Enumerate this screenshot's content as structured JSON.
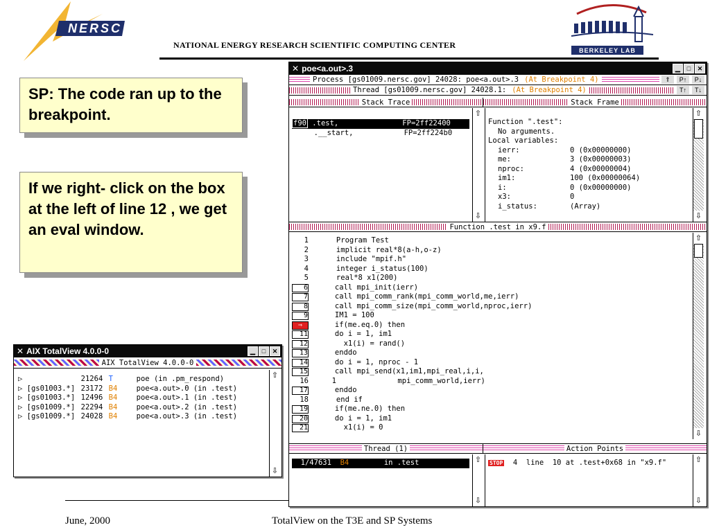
{
  "header": {
    "org_logo": "NERSC",
    "org_title": "National Energy Research Scientific Computing Center",
    "lab_logo": "Berkeley Lab"
  },
  "callouts": [
    {
      "text": "SP: The code ran up to the breakpoint."
    },
    {
      "text": "If we right- click on the box at the left of line 12 , we get an eval window."
    }
  ],
  "process_window": {
    "title": "poe<a.out>.3",
    "process_bar": {
      "text": "Process [gs01009.nersc.gov] 24028: poe<a.out>.3",
      "status": "(At Breakpoint 4)"
    },
    "thread_bar": {
      "text": "Thread [gs01009.nersc.gov] 24028.1:",
      "status": "(At Breakpoint 4)"
    },
    "stack_trace_title": "Stack Trace",
    "stack_trace": [
      {
        "lang": "f90",
        "name": ".test,",
        "fp": "FP=2ff22400",
        "selected": true
      },
      {
        "lang": "",
        "name": ".__start,",
        "fp": "FP=2ff224b0",
        "selected": false
      }
    ],
    "stack_frame_title": "Stack Frame",
    "stack_frame_header": "Function \".test\":",
    "stack_frame_args": "No arguments.",
    "stack_frame_locals_label": "Local variables:",
    "locals": [
      {
        "name": "ierr:",
        "value": "0 (0x00000000)"
      },
      {
        "name": "me:",
        "value": "3 (0x00000003)"
      },
      {
        "name": "nproc:",
        "value": "4 (0x00000004)"
      },
      {
        "name": "im1:",
        "value": "100 (0x00000064)"
      },
      {
        "name": "i:",
        "value": "0 (0x00000000)"
      },
      {
        "name": "x3:",
        "value": "0"
      },
      {
        "name": "i_status:",
        "value": "(Array)"
      }
    ],
    "source_title": "Function .test in x9.f",
    "source_lines": [
      {
        "n": "1",
        "boxed": false,
        "code": "      Program Test"
      },
      {
        "n": "2",
        "boxed": false,
        "code": "      implicit real*8(a-h,o-z)"
      },
      {
        "n": "3",
        "boxed": false,
        "code": "      include \"mpif.h\""
      },
      {
        "n": "4",
        "boxed": false,
        "code": "      integer i_status(100)"
      },
      {
        "n": "5",
        "boxed": false,
        "code": "      real*8 x1(200)"
      },
      {
        "n": "6",
        "boxed": true,
        "code": "      call mpi_init(ierr)"
      },
      {
        "n": "7",
        "boxed": true,
        "code": "      call mpi_comm_rank(mpi_comm_world,me,ierr)"
      },
      {
        "n": "8",
        "boxed": true,
        "code": "      call mpi_comm_size(mpi_comm_world,nproc,ierr)"
      },
      {
        "n": "9",
        "boxed": true,
        "code": "      IM1 = 100"
      },
      {
        "n": "",
        "boxed": false,
        "pc": true,
        "code": "      if(me.eq.0) then"
      },
      {
        "n": "11",
        "boxed": true,
        "code": "      do i = 1, im1"
      },
      {
        "n": "12",
        "boxed": true,
        "code": "        x1(i) = rand()"
      },
      {
        "n": "13",
        "boxed": true,
        "code": "      enddo"
      },
      {
        "n": "14",
        "boxed": true,
        "code": "      do i = 1, nproc - 1"
      },
      {
        "n": "15",
        "boxed": true,
        "code": "      call mpi_send(x1,im1,mpi_real,i,i,"
      },
      {
        "n": "16",
        "boxed": false,
        "code": "     1              mpi_comm_world,ierr)"
      },
      {
        "n": "17",
        "boxed": true,
        "code": "      enddo"
      },
      {
        "n": "18",
        "boxed": false,
        "code": "      end if"
      },
      {
        "n": "19",
        "boxed": true,
        "code": "      if(me.ne.0) then"
      },
      {
        "n": "20",
        "boxed": true,
        "code": "      do i = 1, im1"
      },
      {
        "n": "21",
        "boxed": true,
        "code": "        x1(i) = 0"
      }
    ],
    "thread_list_title": "Thread (1)",
    "thread_entry": {
      "id": "1/47631",
      "state": "B4",
      "loc": "in .test"
    },
    "action_points_title": "Action Points",
    "action_point": {
      "badge": "STOP",
      "num": "4",
      "text": "line  10 at .test+0x68 in \"x9.f\""
    }
  },
  "root_window": {
    "title": "AIX TotalView 4.0.0-0",
    "bar_title": "AIX TotalView 4.0.0-0",
    "processes": [
      {
        "host": "",
        "pid": "21264",
        "state": "T",
        "state_color": "blue",
        "name": "poe (in .pm_respond)"
      },
      {
        "host": "[gs01003.*]",
        "pid": "23172",
        "state": "B4",
        "state_color": "orange",
        "name": "poe<a.out>.0 (in .test)"
      },
      {
        "host": "[gs01003.*]",
        "pid": "12496",
        "state": "B4",
        "state_color": "orange",
        "name": "poe<a.out>.1 (in .test)"
      },
      {
        "host": "[gs01009.*]",
        "pid": "22294",
        "state": "B4",
        "state_color": "orange",
        "name": "poe<a.out>.2 (in .test)"
      },
      {
        "host": "[gs01009.*]",
        "pid": "24028",
        "state": "B4",
        "state_color": "orange",
        "name": "poe<a.out>.3 (in .test)"
      }
    ]
  },
  "footer": {
    "date": "June, 2000",
    "title": "TotalView on the T3E and SP Systems"
  }
}
